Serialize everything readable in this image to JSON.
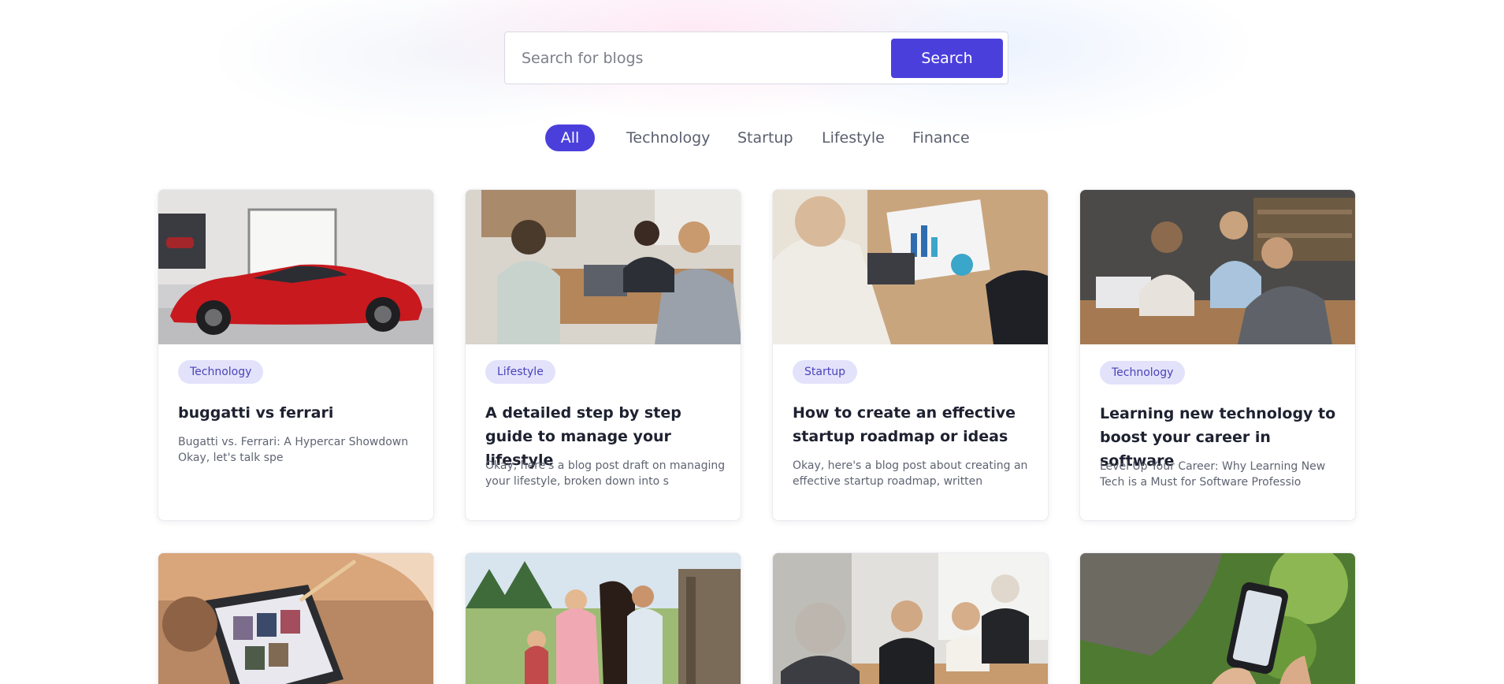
{
  "search": {
    "placeholder": "Search for blogs",
    "button_label": "Search"
  },
  "filters": [
    {
      "label": "All",
      "active": true
    },
    {
      "label": "Technology",
      "active": false
    },
    {
      "label": "Startup",
      "active": false
    },
    {
      "label": "Lifestyle",
      "active": false
    },
    {
      "label": "Finance",
      "active": false
    }
  ],
  "colors": {
    "accent": "#4b3fdc",
    "tag_bg": "#e3e2fb",
    "tag_text": "#4a43b8"
  },
  "posts": [
    {
      "image": "red-sports-car-photo",
      "category": "Technology",
      "title": "buggatti vs ferrari",
      "excerpt": "Bugatti vs. Ferrari: A Hypercar Showdown Okay, let's talk spe"
    },
    {
      "image": "office-meeting-laptop-photo",
      "category": "Lifestyle",
      "title": "A detailed step by step guide to manage your lifestyle",
      "excerpt": "Okay, here's a blog post draft on managing your lifestyle, broken down into s"
    },
    {
      "image": "business-charts-meeting-photo",
      "category": "Startup",
      "title": "How to create an effective startup roadmap or ideas",
      "excerpt": "Okay, here's a blog post about creating an effective startup roadmap, written"
    },
    {
      "image": "team-laptop-collaboration-photo",
      "category": "Technology",
      "title": "Learning new technology to boost your career in software",
      "excerpt": "Level Up Your Career: Why Learning New Tech is a Must for Software Professio"
    },
    {
      "image": "tablet-stylus-photo"
    },
    {
      "image": "family-with-horse-photo"
    },
    {
      "image": "senior-business-meeting-photo"
    },
    {
      "image": "phone-in-hands-photo"
    }
  ]
}
